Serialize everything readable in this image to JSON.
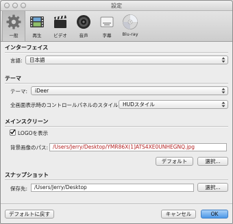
{
  "window": {
    "title": "設定"
  },
  "toolbar": {
    "items": [
      {
        "label": "一般",
        "icon": "gear-icon"
      },
      {
        "label": "再生",
        "icon": "filmstrip-icon"
      },
      {
        "label": "ビデオ",
        "icon": "clapperboard-icon"
      },
      {
        "label": "音声",
        "icon": "speaker-icon"
      },
      {
        "label": "字幕",
        "icon": "subtitle-icon"
      },
      {
        "label": "Blu-ray",
        "icon": "disc-icon"
      }
    ]
  },
  "interface": {
    "title": "インターフェイス",
    "language_label": "言語:",
    "language_value": "日本語"
  },
  "theme": {
    "title": "テーマ",
    "theme_label": "テーマ:",
    "theme_value": "iDeer",
    "fullscreen_label": "全画面表示時のコントロールパネルのスタイル:",
    "fullscreen_value": "HUDスタイル"
  },
  "main_screen": {
    "title": "メインスクリーン",
    "show_logo_label": "LOGOを表示",
    "show_logo_checked": true,
    "bg_path_label": "背景画像のパス:",
    "bg_path_value": "/Users/Jerry/Desktop/YMR86X(1]ATS4XE0UNHEGNQ.jpg",
    "default_button": "デフォルト",
    "browse_button": "選択..."
  },
  "snapshot": {
    "title": "スナップショット",
    "save_label": "保存先:",
    "save_value": "/Users/Jerry/Desktop",
    "browse_button": "選択..."
  },
  "footer": {
    "reset_button": "デフォルトに戻す",
    "cancel_button": "キャンセル",
    "ok_button": "OK"
  },
  "colors": {
    "accent": "#4b97e8",
    "path_text": "#b21d1d"
  }
}
